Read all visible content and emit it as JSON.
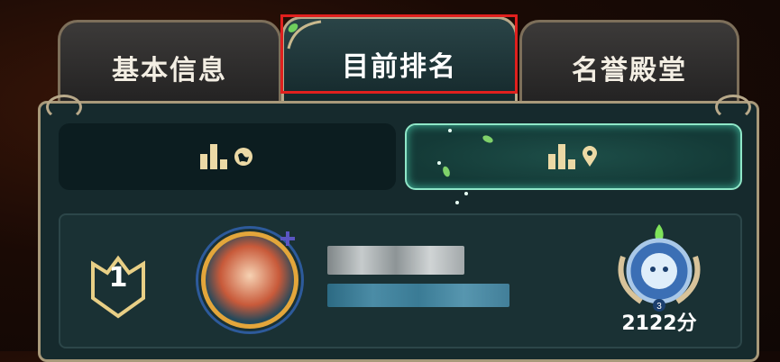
{
  "tabs": [
    {
      "label": "基本信息",
      "active": false
    },
    {
      "label": "目前排名",
      "active": true
    },
    {
      "label": "名誉殿堂",
      "active": false
    }
  ],
  "scope_toggle": [
    {
      "icon": "global-ranking-icon",
      "selected": false
    },
    {
      "icon": "local-ranking-icon",
      "selected": true
    }
  ],
  "player": {
    "rank": "1",
    "name": "",
    "subtitle": "",
    "tier_level": "3",
    "score": "2122分"
  },
  "colors": {
    "highlight": "#e0201e",
    "active_border": "#8fe7c8",
    "panel_border": "#a8997a"
  }
}
